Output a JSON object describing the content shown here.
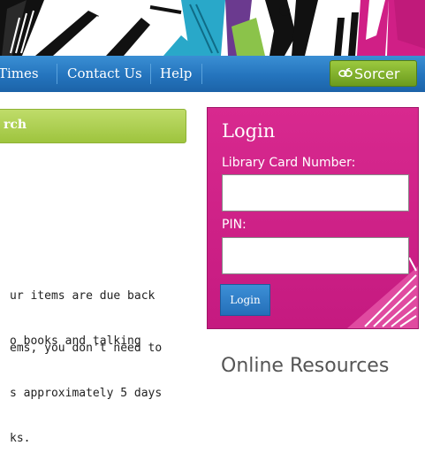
{
  "nav": {
    "items": [
      {
        "label": "Times"
      },
      {
        "label": "Contact Us"
      },
      {
        "label": "Help"
      }
    ],
    "sorcer_label": "Sorcer",
    "sorcer_icon": "link-icon"
  },
  "search": {
    "label": "rch"
  },
  "content": {
    "p1": [
      "ur items are due back",
      "o books and talking"
    ],
    "p2": [
      "ems, you don't need to",
      "s approximately 5 days",
      "ks."
    ]
  },
  "login": {
    "title": "Login",
    "card_label": "Library Card Number:",
    "card_value": "",
    "pin_label": "PIN:",
    "pin_value": "",
    "button_label": "Login"
  },
  "online_resources": {
    "heading": "Online Resources"
  },
  "colors": {
    "nav": "#2474bd",
    "login_box": "#d01f86",
    "sorcer_button": "#82b22a",
    "search_bar": "#aecf4f"
  }
}
